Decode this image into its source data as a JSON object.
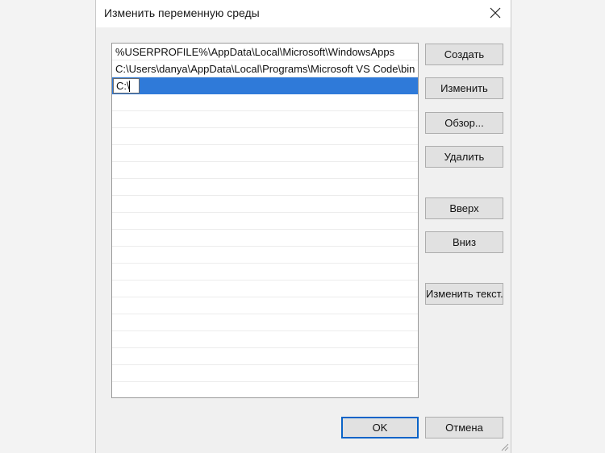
{
  "dialog": {
    "title": "Изменить переменную среды"
  },
  "paths": [
    "%USERPROFILE%\\AppData\\Local\\Microsoft\\WindowsApps",
    "C:\\Users\\danya\\AppData\\Local\\Programs\\Microsoft VS Code\\bin"
  ],
  "edit_value": "C:\\",
  "buttons": {
    "create": "Создать",
    "edit": "Изменить",
    "browse": "Обзор...",
    "delete": "Удалить",
    "up": "Вверх",
    "down": "Вниз",
    "edit_text": "Изменить текст...",
    "ok": "OK",
    "cancel": "Отмена"
  },
  "icons": {
    "close": "close-icon",
    "resize": "resize-grip-icon"
  },
  "colors": {
    "selection": "#2f7ad9",
    "ok_border": "#0a64c8"
  }
}
